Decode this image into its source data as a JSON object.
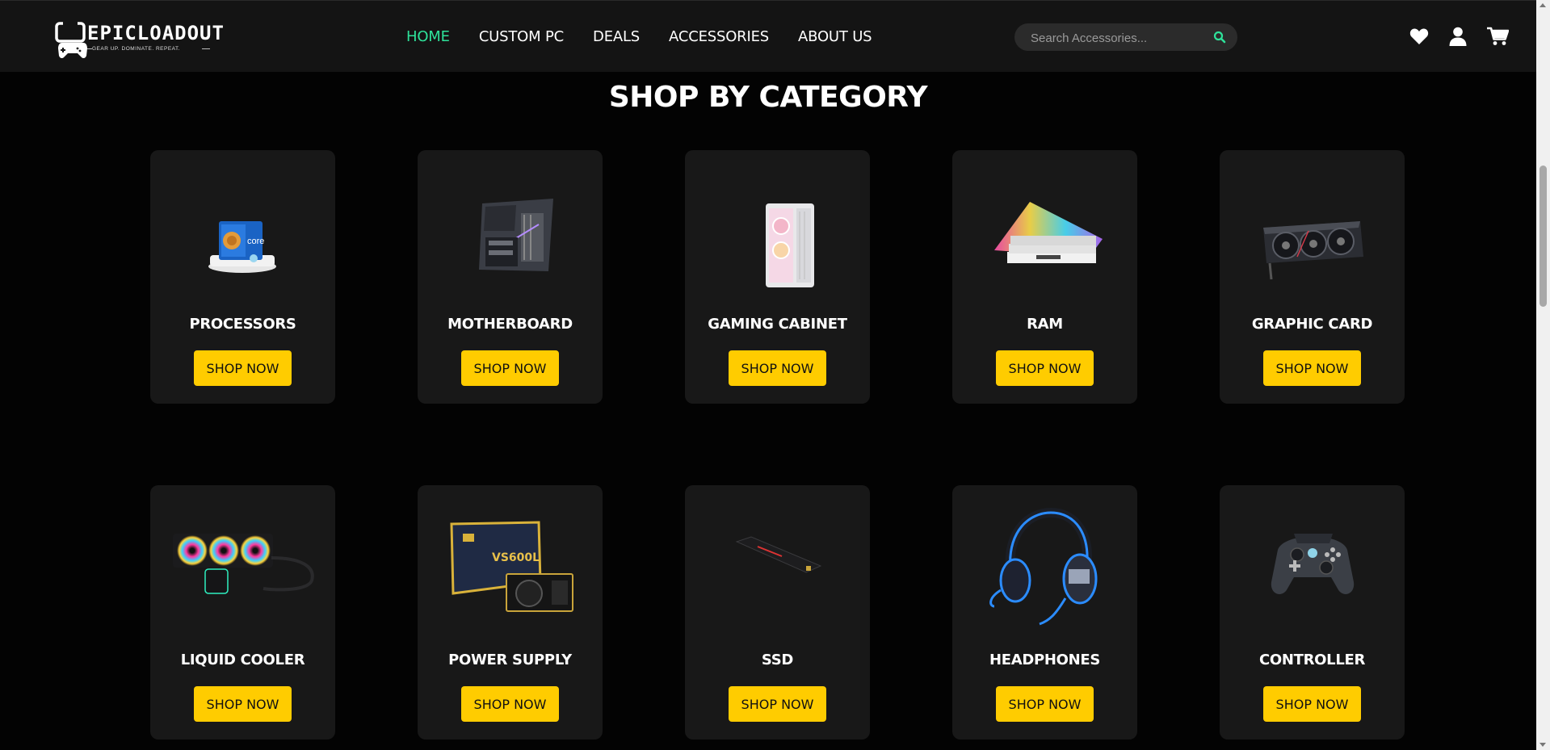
{
  "brand": {
    "logo_text": "EPICLOADOUT",
    "tagline": "GEAR UP. DOMINATE. REPEAT."
  },
  "nav": {
    "items": [
      {
        "label": "HOME",
        "active": true
      },
      {
        "label": "CUSTOM PC",
        "active": false
      },
      {
        "label": "DEALS",
        "active": false
      },
      {
        "label": "ACCESSORIES",
        "active": false
      },
      {
        "label": "ABOUT US",
        "active": false
      }
    ],
    "active_color": "#2ee29a"
  },
  "search": {
    "placeholder": "Search Accessories...",
    "value": "",
    "icon": "search-icon"
  },
  "header_icons": [
    "heart-icon",
    "user-icon",
    "cart-icon"
  ],
  "section": {
    "heading": "SHOP BY CATEGORY"
  },
  "categories": [
    {
      "name": "PROCESSORS",
      "button": "SHOP NOW",
      "image": "processor-image"
    },
    {
      "name": "MOTHERBOARD",
      "button": "SHOP NOW",
      "image": "motherboard-image"
    },
    {
      "name": "GAMING CABINET",
      "button": "SHOP NOW",
      "image": "gaming-cabinet-image"
    },
    {
      "name": "RAM",
      "button": "SHOP NOW",
      "image": "ram-image"
    },
    {
      "name": "GRAPHIC CARD",
      "button": "SHOP NOW",
      "image": "graphic-card-image"
    },
    {
      "name": "LIQUID COOLER",
      "button": "SHOP NOW",
      "image": "liquid-cooler-image"
    },
    {
      "name": "POWER SUPPLY",
      "button": "SHOP NOW",
      "image": "power-supply-image"
    },
    {
      "name": "SSD",
      "button": "SHOP NOW",
      "image": "ssd-image"
    },
    {
      "name": "HEADPHONES",
      "button": "SHOP NOW",
      "image": "headphones-image"
    },
    {
      "name": "CONTROLLER",
      "button": "SHOP NOW",
      "image": "controller-image"
    }
  ],
  "colors": {
    "page_bg": "#030303",
    "header_bg": "#141414",
    "card_bg": "#181818",
    "button_bg": "#ffcc00",
    "accent": "#2ee29a"
  }
}
